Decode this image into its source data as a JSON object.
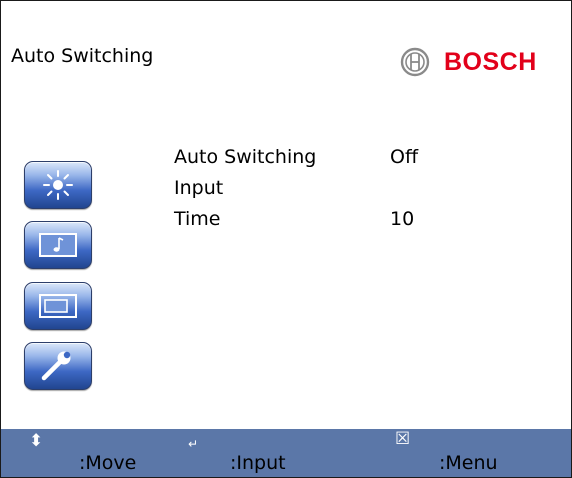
{
  "header": {
    "title": "Auto Switching",
    "brand_name": "BOSCH",
    "brand_logo_icon": "bosch-armature-logo"
  },
  "sidebar": {
    "buttons": [
      {
        "name": "picture",
        "icon": "sun-icon"
      },
      {
        "name": "audio",
        "icon": "music-note-icon"
      },
      {
        "name": "display",
        "icon": "window-icon"
      },
      {
        "name": "setup",
        "icon": "wrench-icon"
      }
    ]
  },
  "menu": {
    "items": [
      {
        "label": "Auto Switching",
        "value": "Off"
      },
      {
        "label": "Input",
        "value": ""
      },
      {
        "label": "Time",
        "value": "10"
      }
    ]
  },
  "footer": {
    "hints": [
      {
        "icon": "up-down-arrows-icon",
        "glyph": "⬍",
        "label": ":Move"
      },
      {
        "icon": "enter-icon",
        "glyph": "↵",
        "label": ":Input"
      },
      {
        "icon": "close-box-icon",
        "glyph": "☒",
        "label": ":Menu"
      }
    ]
  },
  "colors": {
    "brand": "#e2001a",
    "footer_bg": "#5b77a8",
    "button_dark": "#21458f",
    "button_light": "#dbe7fa"
  }
}
